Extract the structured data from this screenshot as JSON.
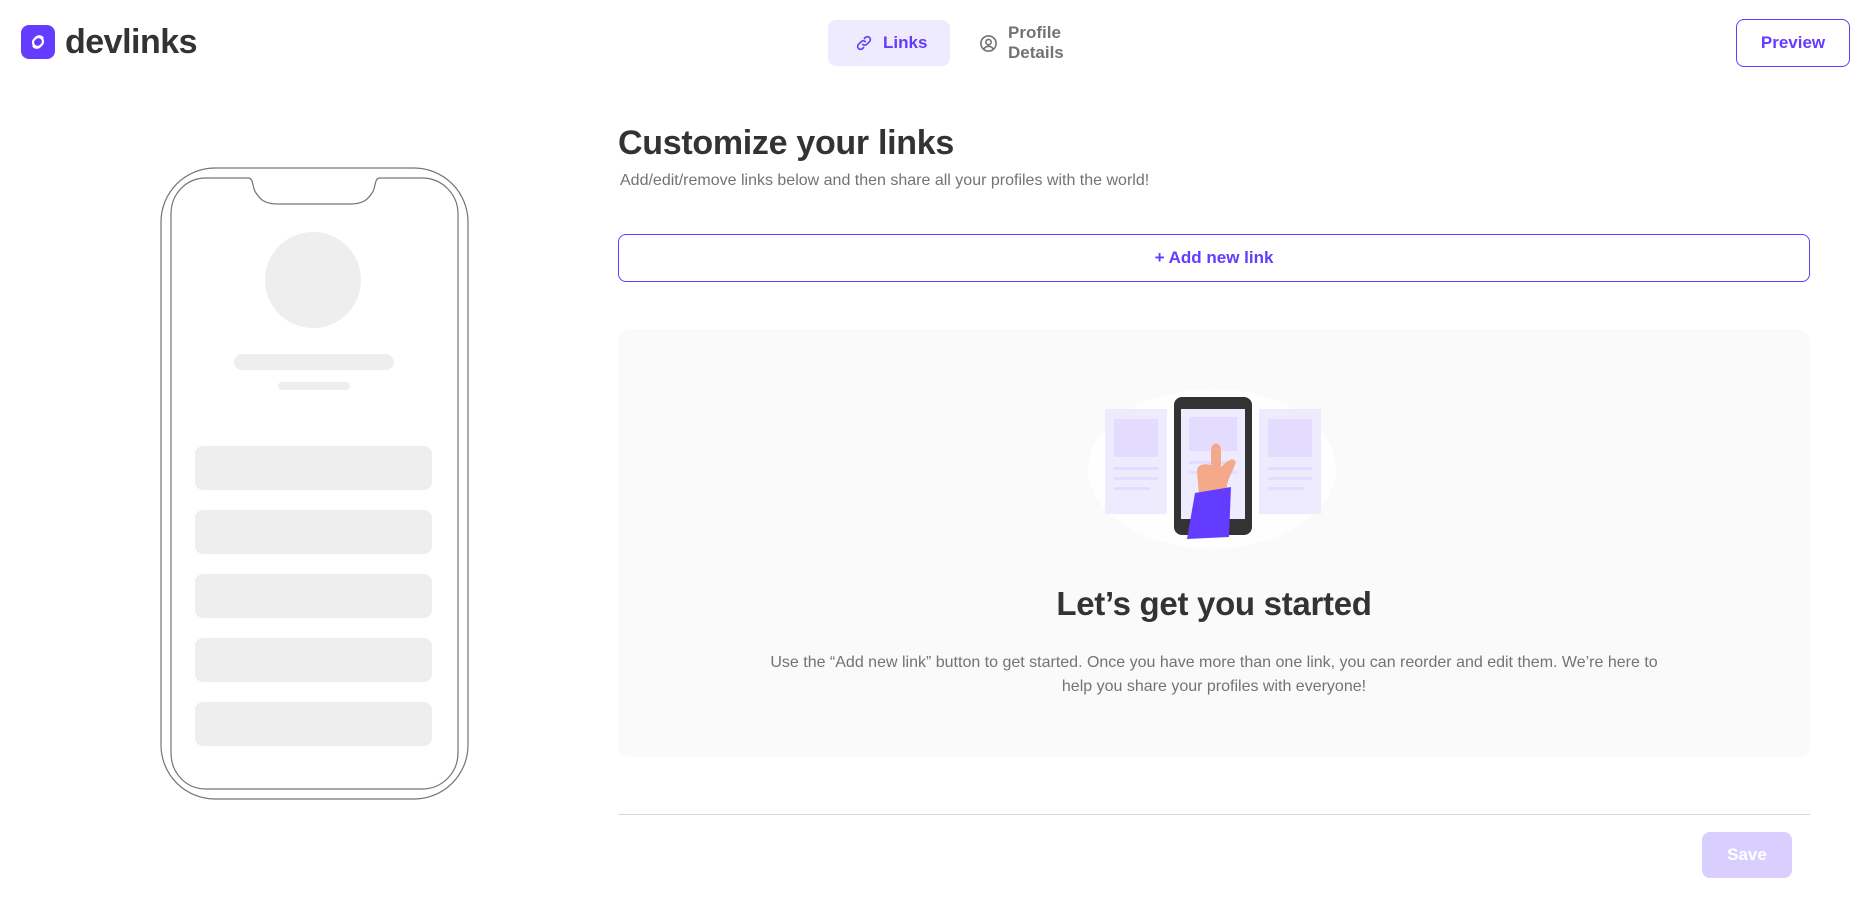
{
  "app": {
    "name": "devlinks"
  },
  "nav": {
    "tabs": [
      {
        "label": "Links",
        "icon": "link-icon",
        "active": true
      },
      {
        "label": "Profile Details",
        "icon": "user-circle-icon",
        "active": false
      }
    ],
    "preview_label": "Preview"
  },
  "main": {
    "title": "Customize your links",
    "subtitle": "Add/edit/remove links below and then share all your profiles with the world!",
    "add_link_label": "+ Add new link",
    "empty_state": {
      "title": "Let’s get you started",
      "body": "Use the “Add new link” button to get started. Once you have more than one link, you can reorder and edit them. We’re here to help you share your profiles with everyone!"
    },
    "save_label": "Save"
  },
  "colors": {
    "accent": "#633CFF",
    "accent_light": "#EFEBFF",
    "accent_disabled": "#D9CFFF",
    "text_dark": "#333333",
    "text_grey": "#737373",
    "card_bg": "#FAFAFA",
    "placeholder": "#EEEEEE"
  }
}
